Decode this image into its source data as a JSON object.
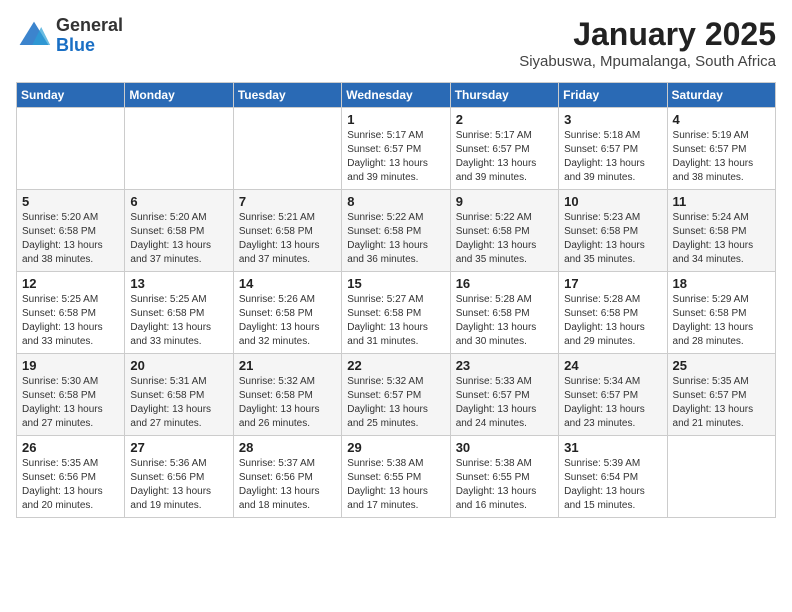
{
  "logo": {
    "general": "General",
    "blue": "Blue"
  },
  "title": "January 2025",
  "location": "Siyabuswa, Mpumalanga, South Africa",
  "days": [
    "Sunday",
    "Monday",
    "Tuesday",
    "Wednesday",
    "Thursday",
    "Friday",
    "Saturday"
  ],
  "weeks": [
    [
      {
        "date": "",
        "sunrise": "",
        "sunset": "",
        "daylight": ""
      },
      {
        "date": "",
        "sunrise": "",
        "sunset": "",
        "daylight": ""
      },
      {
        "date": "",
        "sunrise": "",
        "sunset": "",
        "daylight": ""
      },
      {
        "date": "1",
        "sunrise": "Sunrise: 5:17 AM",
        "sunset": "Sunset: 6:57 PM",
        "daylight": "Daylight: 13 hours and 39 minutes."
      },
      {
        "date": "2",
        "sunrise": "Sunrise: 5:17 AM",
        "sunset": "Sunset: 6:57 PM",
        "daylight": "Daylight: 13 hours and 39 minutes."
      },
      {
        "date": "3",
        "sunrise": "Sunrise: 5:18 AM",
        "sunset": "Sunset: 6:57 PM",
        "daylight": "Daylight: 13 hours and 39 minutes."
      },
      {
        "date": "4",
        "sunrise": "Sunrise: 5:19 AM",
        "sunset": "Sunset: 6:57 PM",
        "daylight": "Daylight: 13 hours and 38 minutes."
      }
    ],
    [
      {
        "date": "5",
        "sunrise": "Sunrise: 5:20 AM",
        "sunset": "Sunset: 6:58 PM",
        "daylight": "Daylight: 13 hours and 38 minutes."
      },
      {
        "date": "6",
        "sunrise": "Sunrise: 5:20 AM",
        "sunset": "Sunset: 6:58 PM",
        "daylight": "Daylight: 13 hours and 37 minutes."
      },
      {
        "date": "7",
        "sunrise": "Sunrise: 5:21 AM",
        "sunset": "Sunset: 6:58 PM",
        "daylight": "Daylight: 13 hours and 37 minutes."
      },
      {
        "date": "8",
        "sunrise": "Sunrise: 5:22 AM",
        "sunset": "Sunset: 6:58 PM",
        "daylight": "Daylight: 13 hours and 36 minutes."
      },
      {
        "date": "9",
        "sunrise": "Sunrise: 5:22 AM",
        "sunset": "Sunset: 6:58 PM",
        "daylight": "Daylight: 13 hours and 35 minutes."
      },
      {
        "date": "10",
        "sunrise": "Sunrise: 5:23 AM",
        "sunset": "Sunset: 6:58 PM",
        "daylight": "Daylight: 13 hours and 35 minutes."
      },
      {
        "date": "11",
        "sunrise": "Sunrise: 5:24 AM",
        "sunset": "Sunset: 6:58 PM",
        "daylight": "Daylight: 13 hours and 34 minutes."
      }
    ],
    [
      {
        "date": "12",
        "sunrise": "Sunrise: 5:25 AM",
        "sunset": "Sunset: 6:58 PM",
        "daylight": "Daylight: 13 hours and 33 minutes."
      },
      {
        "date": "13",
        "sunrise": "Sunrise: 5:25 AM",
        "sunset": "Sunset: 6:58 PM",
        "daylight": "Daylight: 13 hours and 33 minutes."
      },
      {
        "date": "14",
        "sunrise": "Sunrise: 5:26 AM",
        "sunset": "Sunset: 6:58 PM",
        "daylight": "Daylight: 13 hours and 32 minutes."
      },
      {
        "date": "15",
        "sunrise": "Sunrise: 5:27 AM",
        "sunset": "Sunset: 6:58 PM",
        "daylight": "Daylight: 13 hours and 31 minutes."
      },
      {
        "date": "16",
        "sunrise": "Sunrise: 5:28 AM",
        "sunset": "Sunset: 6:58 PM",
        "daylight": "Daylight: 13 hours and 30 minutes."
      },
      {
        "date": "17",
        "sunrise": "Sunrise: 5:28 AM",
        "sunset": "Sunset: 6:58 PM",
        "daylight": "Daylight: 13 hours and 29 minutes."
      },
      {
        "date": "18",
        "sunrise": "Sunrise: 5:29 AM",
        "sunset": "Sunset: 6:58 PM",
        "daylight": "Daylight: 13 hours and 28 minutes."
      }
    ],
    [
      {
        "date": "19",
        "sunrise": "Sunrise: 5:30 AM",
        "sunset": "Sunset: 6:58 PM",
        "daylight": "Daylight: 13 hours and 27 minutes."
      },
      {
        "date": "20",
        "sunrise": "Sunrise: 5:31 AM",
        "sunset": "Sunset: 6:58 PM",
        "daylight": "Daylight: 13 hours and 27 minutes."
      },
      {
        "date": "21",
        "sunrise": "Sunrise: 5:32 AM",
        "sunset": "Sunset: 6:58 PM",
        "daylight": "Daylight: 13 hours and 26 minutes."
      },
      {
        "date": "22",
        "sunrise": "Sunrise: 5:32 AM",
        "sunset": "Sunset: 6:57 PM",
        "daylight": "Daylight: 13 hours and 25 minutes."
      },
      {
        "date": "23",
        "sunrise": "Sunrise: 5:33 AM",
        "sunset": "Sunset: 6:57 PM",
        "daylight": "Daylight: 13 hours and 24 minutes."
      },
      {
        "date": "24",
        "sunrise": "Sunrise: 5:34 AM",
        "sunset": "Sunset: 6:57 PM",
        "daylight": "Daylight: 13 hours and 23 minutes."
      },
      {
        "date": "25",
        "sunrise": "Sunrise: 5:35 AM",
        "sunset": "Sunset: 6:57 PM",
        "daylight": "Daylight: 13 hours and 21 minutes."
      }
    ],
    [
      {
        "date": "26",
        "sunrise": "Sunrise: 5:35 AM",
        "sunset": "Sunset: 6:56 PM",
        "daylight": "Daylight: 13 hours and 20 minutes."
      },
      {
        "date": "27",
        "sunrise": "Sunrise: 5:36 AM",
        "sunset": "Sunset: 6:56 PM",
        "daylight": "Daylight: 13 hours and 19 minutes."
      },
      {
        "date": "28",
        "sunrise": "Sunrise: 5:37 AM",
        "sunset": "Sunset: 6:56 PM",
        "daylight": "Daylight: 13 hours and 18 minutes."
      },
      {
        "date": "29",
        "sunrise": "Sunrise: 5:38 AM",
        "sunset": "Sunset: 6:55 PM",
        "daylight": "Daylight: 13 hours and 17 minutes."
      },
      {
        "date": "30",
        "sunrise": "Sunrise: 5:38 AM",
        "sunset": "Sunset: 6:55 PM",
        "daylight": "Daylight: 13 hours and 16 minutes."
      },
      {
        "date": "31",
        "sunrise": "Sunrise: 5:39 AM",
        "sunset": "Sunset: 6:54 PM",
        "daylight": "Daylight: 13 hours and 15 minutes."
      },
      {
        "date": "",
        "sunrise": "",
        "sunset": "",
        "daylight": ""
      }
    ]
  ]
}
